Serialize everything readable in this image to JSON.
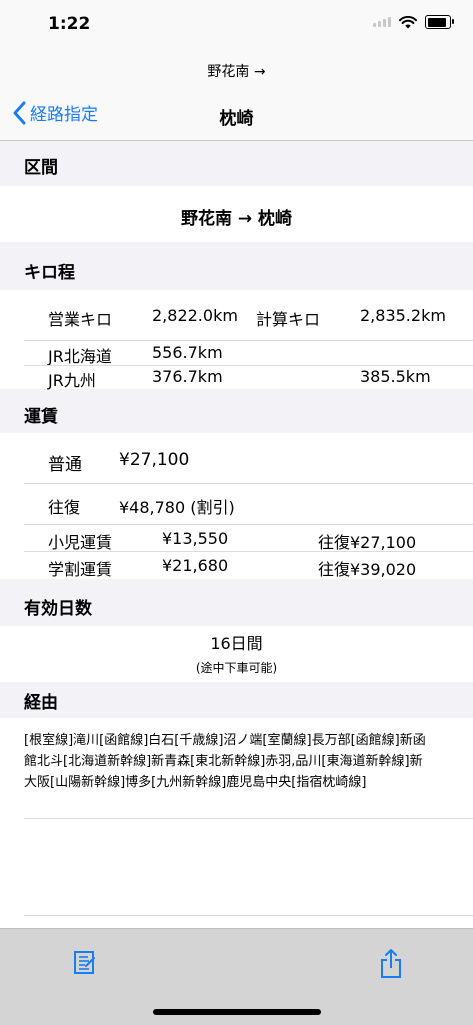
{
  "status": {
    "time": "1:22"
  },
  "nav": {
    "prompt": "野花南 →",
    "back_label": "経路指定",
    "title": "枕崎"
  },
  "section": {
    "interval_header": "区間",
    "distance_header": "キロ程",
    "fare_header": "運賃",
    "validity_header": "有効日数",
    "via_header": "経由"
  },
  "interval": {
    "route": "野花南 → 枕崎"
  },
  "distance": {
    "sales_label": "営業キロ",
    "sales_value": "2,822.0km",
    "calc_label": "計算キロ",
    "calc_value": "2,835.2km",
    "jr_hokkaido_label": "JR北海道",
    "jr_hokkaido_value": "556.7km",
    "jr_kyushu_label": "JR九州",
    "jr_kyushu_value": "376.7km",
    "jr_kyushu_calc": "385.5km"
  },
  "fare": {
    "normal_label": "普通",
    "normal_value": "¥27,100",
    "round_label": "往復",
    "round_value": "¥48,780 (割引)",
    "child_label": "小児運賃",
    "child_value": "¥13,550",
    "child_round": "往復¥27,100",
    "student_label": "学割運賃",
    "student_value": "¥21,680",
    "student_round": "往復¥39,020"
  },
  "validity": {
    "days": "16日間",
    "note": "(途中下車可能)"
  },
  "via": {
    "line1": "[根室線]滝川[函館線]白石[千歳線]沼ノ端[室蘭線]長万部[函館線]新函",
    "line2": "館北斗[北海道新幹線]新青森[東北新幹線]赤羽,品川[東海道新幹線]新",
    "line3": "大阪[山陽新幹線]博多[九州新幹線]鹿児島中央[指宿枕崎線]"
  },
  "colors": {
    "accent": "#1a7cf5",
    "background": "#f2f2f7",
    "toolbar": "#d4d4d4"
  },
  "icons": {
    "back": "chevron-left-icon",
    "compose": "compose-icon",
    "share": "share-icon"
  }
}
